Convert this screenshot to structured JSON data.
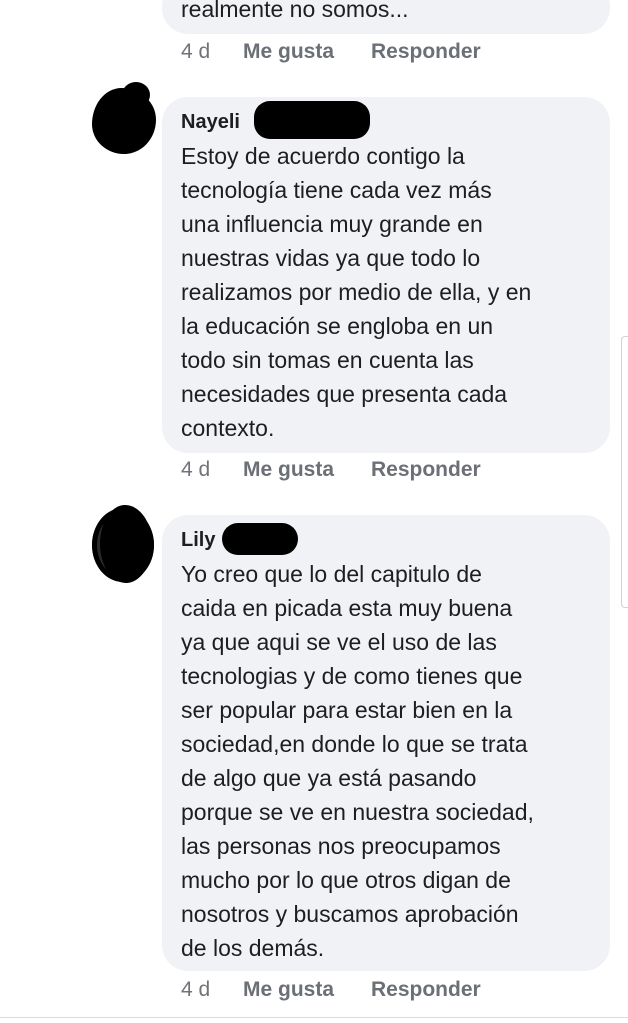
{
  "comments": [
    {
      "author": "",
      "text": "realmente no somos...",
      "time": "4 d",
      "like_label": "Me gusta",
      "reply_label": "Responder"
    },
    {
      "author": "Nayeli",
      "text": "Estoy de acuerdo contigo la\ntecnología tiene cada vez más\nuna influencia muy grande en\nnuestras vidas ya que todo lo\nrealizamos por medio de ella, y en\nla educación se engloba en un\ntodo sin tomas en cuenta las\nnecesidades que presenta cada\ncontexto.",
      "time": "4 d",
      "like_label": "Me gusta",
      "reply_label": "Responder"
    },
    {
      "author": "Lily",
      "text": "Yo creo que lo del capitulo de\ncaida en picada esta muy buena\nya que aqui se ve el uso de las\ntecnologias y de como tienes que\nser popular para estar bien en la\nsociedad,en donde lo que  se trata\nde algo que ya está pasando\nporque se ve en nuestra sociedad,\nlas personas nos preocupamos\nmucho por lo que otros digan de\nnosotros y buscamos aprobación\nde los demás.",
      "time": "4 d",
      "like_label": "Me gusta",
      "reply_label": "Responder"
    }
  ]
}
